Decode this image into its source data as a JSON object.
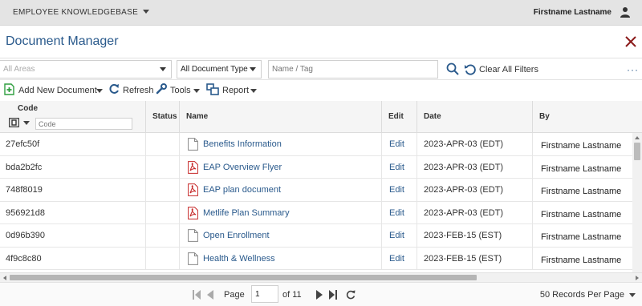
{
  "topbar": {
    "knowledgebase_label": "EMPLOYEE KNOWLEDGEBASE",
    "user_name": "Firstname Lastname",
    "user_icon": "user-icon"
  },
  "header": {
    "title": "Document Manager",
    "close_icon": "close-icon"
  },
  "filters": {
    "areas_placeholder": "All Areas",
    "doc_type_value": "All Document Type",
    "name_tag_placeholder": "Name / Tag",
    "clear_label": "Clear All Filters",
    "more_label": "···"
  },
  "toolbar": {
    "add_label": "Add New Document",
    "refresh_label": "Refresh",
    "tools_label": "Tools",
    "report_label": "Report"
  },
  "table": {
    "columns": {
      "code": "Code",
      "status": "Status",
      "name": "Name",
      "edit": "Edit",
      "date": "Date",
      "by": "By"
    },
    "code_filter_placeholder": "Code",
    "rows": [
      {
        "code": "27efc50f",
        "name": "Benefits Information",
        "file_type": "doc",
        "edit": "Edit",
        "date": "2023-APR-03 (EDT)",
        "by": "Firstname Lastname"
      },
      {
        "code": "bda2b2fc",
        "name": "EAP Overview Flyer",
        "file_type": "pdf",
        "edit": "Edit",
        "date": "2023-APR-03 (EDT)",
        "by": "Firstname Lastname"
      },
      {
        "code": "748f8019",
        "name": "EAP plan document",
        "file_type": "pdf",
        "edit": "Edit",
        "date": "2023-APR-03 (EDT)",
        "by": "Firstname Lastname"
      },
      {
        "code": "956921d8",
        "name": "Metlife Plan Summary",
        "file_type": "pdf",
        "edit": "Edit",
        "date": "2023-APR-03 (EDT)",
        "by": "Firstname Lastname"
      },
      {
        "code": "0d96b390",
        "name": "Open Enrollment",
        "file_type": "doc",
        "edit": "Edit",
        "date": "2023-FEB-15 (EST)",
        "by": "Firstname Lastname"
      },
      {
        "code": "4f9c8c80",
        "name": "Health & Wellness",
        "file_type": "doc",
        "edit": "Edit",
        "date": "2023-FEB-15 (EST)",
        "by": "Firstname Lastname"
      }
    ]
  },
  "pager": {
    "page_label": "Page",
    "current_page": "1",
    "of_label": "of 11",
    "records_per_page": "50 Records Per Page"
  },
  "colors": {
    "accent_blue": "#2a5a8c",
    "close_red": "#8b1a1a",
    "add_green": "#2e9e3e",
    "pdf_red": "#c62828"
  }
}
